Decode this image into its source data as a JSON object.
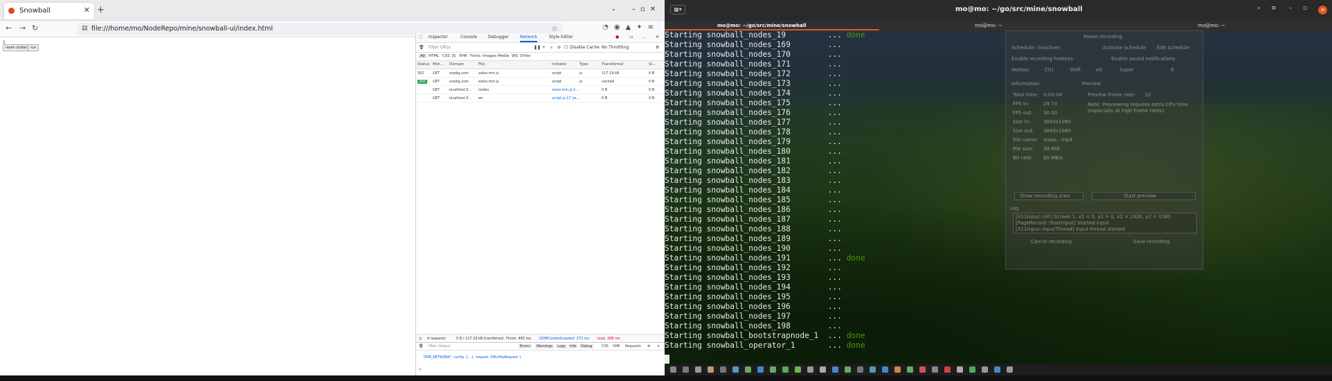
{
  "firefox": {
    "tab_title": "Snowball",
    "url": "file:///home/mo/NodeRepo/mine/snowball-ui/index.html",
    "page": {
      "line1": "1",
      "reset_label": "reset cluster",
      "run_label": "run"
    },
    "devtools": {
      "tabs": [
        "Inspector",
        "Console",
        "Debugger",
        "Network",
        "Style Editor"
      ],
      "filter_placeholder": "Filter URLs",
      "disable_cache": "Disable Cache",
      "throttling": "No Throttling",
      "types": [
        "All",
        "HTML",
        "CSS",
        "JS",
        "XHR",
        "Fonts",
        "Images",
        "Media",
        "WS",
        "Other"
      ],
      "columns": [
        "Status",
        "Met...",
        "Domain",
        "File",
        "Initiator",
        "Type",
        "Transferred",
        "Si..."
      ],
      "requests": [
        {
          "status": "302",
          "method": "GET",
          "domain": "unpkg.com",
          "file": "axios.min.js",
          "initiator": "script",
          "type": "js",
          "transferred": "117.19 kB",
          "size": "0 B"
        },
        {
          "status": "200",
          "method": "GET",
          "domain": "unpkg.com",
          "file": "axios.min.js",
          "initiator": "script",
          "type": "js",
          "transferred": "cached",
          "size": "0 B"
        },
        {
          "status": "",
          "method": "GET",
          "domain": "localhost:3...",
          "file": "nodes",
          "initiator": "axios.min.js:1 ...",
          "type": "",
          "transferred": "0 B",
          "size": "0 B"
        },
        {
          "status": "",
          "method": "GET",
          "domain": "localhost:3...",
          "file": "ws",
          "initiator": "script.js:17 (w...",
          "type": "",
          "transferred": "0 B",
          "size": "0 B"
        }
      ],
      "summary": {
        "requests": "4 requests",
        "transferred": "0 B / 117.19 kB transferred",
        "finish": "Finish: 465 ms",
        "dcl": "DOMContentLoaded: 273 ms",
        "load": "load: 288 ms"
      },
      "console": {
        "filter_placeholder": "Filter Output",
        "levels": [
          "Errors",
          "Warnings",
          "Logs",
          "Info",
          "Debug"
        ],
        "extra": [
          "CSS",
          "XHR",
          "Requests"
        ],
        "error_line1": "...",
        "error_line2": "\"ERR_NETWORK\", config: {…}, request: XMLHttpRequest }"
      }
    }
  },
  "terminal": {
    "title": "mo@mo: ~/go/src/mine/snowball",
    "tabs": [
      "mo@mo: ~/go/src/mine/snowball",
      "mo@mo: ~",
      "mo@mo: ~"
    ],
    "lines": [
      {
        "text": "Starting snowball_nodes_19         ... ",
        "status": "done"
      },
      {
        "text": "Starting snowball_nodes_169        ...",
        "status": ""
      },
      {
        "text": "Starting snowball_nodes_170        ...",
        "status": ""
      },
      {
        "text": "Starting snowball_nodes_171        ...",
        "status": ""
      },
      {
        "text": "Starting snowball_nodes_172        ...",
        "status": ""
      },
      {
        "text": "Starting snowball_nodes_173        ...",
        "status": ""
      },
      {
        "text": "Starting snowball_nodes_174        ...",
        "status": ""
      },
      {
        "text": "Starting snowball_nodes_175        ...",
        "status": ""
      },
      {
        "text": "Starting snowball_nodes_176        ...",
        "status": ""
      },
      {
        "text": "Starting snowball_nodes_177        ...",
        "status": ""
      },
      {
        "text": "Starting snowball_nodes_178        ...",
        "status": ""
      },
      {
        "text": "Starting snowball_nodes_179        ...",
        "status": ""
      },
      {
        "text": "Starting snowball_nodes_180        ...",
        "status": ""
      },
      {
        "text": "Starting snowball_nodes_181        ...",
        "status": ""
      },
      {
        "text": "Starting snowball_nodes_182        ...",
        "status": ""
      },
      {
        "text": "Starting snowball_nodes_183        ...",
        "status": ""
      },
      {
        "text": "Starting snowball_nodes_184        ...",
        "status": ""
      },
      {
        "text": "Starting snowball_nodes_185        ...",
        "status": ""
      },
      {
        "text": "Starting snowball_nodes_186        ...",
        "status": ""
      },
      {
        "text": "Starting snowball_nodes_187        ...",
        "status": ""
      },
      {
        "text": "Starting snowball_nodes_188        ...",
        "status": ""
      },
      {
        "text": "Starting snowball_nodes_189        ...",
        "status": ""
      },
      {
        "text": "Starting snowball_nodes_190        ...",
        "status": ""
      },
      {
        "text": "Starting snowball_nodes_191        ... ",
        "status": "done"
      },
      {
        "text": "Starting snowball_nodes_192        ...",
        "status": ""
      },
      {
        "text": "Starting snowball_nodes_193        ...",
        "status": ""
      },
      {
        "text": "Starting snowball_nodes_194        ...",
        "status": ""
      },
      {
        "text": "Starting snowball_nodes_195        ...",
        "status": ""
      },
      {
        "text": "Starting snowball_nodes_196        ...",
        "status": ""
      },
      {
        "text": "Starting snowball_nodes_197        ...",
        "status": ""
      },
      {
        "text": "Starting snowball_nodes_198        ...",
        "status": ""
      },
      {
        "text": "Starting snowball_bootstrapnode_1  ... ",
        "status": "done"
      },
      {
        "text": "Starting snowball_operator_1       ... ",
        "status": "done"
      }
    ]
  },
  "obs": {
    "pause": "Pause recording",
    "schedule": "Schedule: (inactive)",
    "activate": "Activate schedule",
    "edit": "Edit schedule",
    "hotkeys": "Enable recording hotkeys",
    "notify": "Enable sound notifications",
    "hotkey_label": "Hotkey:",
    "ctrl": "Ctrl",
    "shift": "Shift",
    "alt": "Alt",
    "super": "Super",
    "key": "R",
    "info": "Information",
    "preview": "Preview",
    "preview_rate": "Preview frame rate:",
    "preview_rate_val": "10",
    "note": "Note: Previewing requires extra CPU time (especially at high frame rates).",
    "stats": [
      {
        "k": "Total time:",
        "v": "0:00:04"
      },
      {
        "k": "FPS in:",
        "v": "29.73"
      },
      {
        "k": "FPS out:",
        "v": "30.00"
      },
      {
        "k": "Size in:",
        "v": "3840x1080"
      },
      {
        "k": "Size out:",
        "v": "3840x1080"
      },
      {
        "k": "File name:",
        "v": "snow....mp4"
      },
      {
        "k": "File size:",
        "v": "39 MiB"
      },
      {
        "k": "Bit rate:",
        "v": "80 MB/s"
      }
    ],
    "show_area": "Show recording area",
    "start_preview": "Start preview",
    "log": "Log",
    "log1": "[X11Input::init] Screen 1: x1 = 0, y1 = 0, x2 = 1920, y2 = 1080",
    "log2": "[PageRecord::StartInput] Started input.",
    "log3": "[X11Input::InputThread] Input thread started.",
    "cancel": "Cancel recording",
    "save": "Save recording"
  }
}
